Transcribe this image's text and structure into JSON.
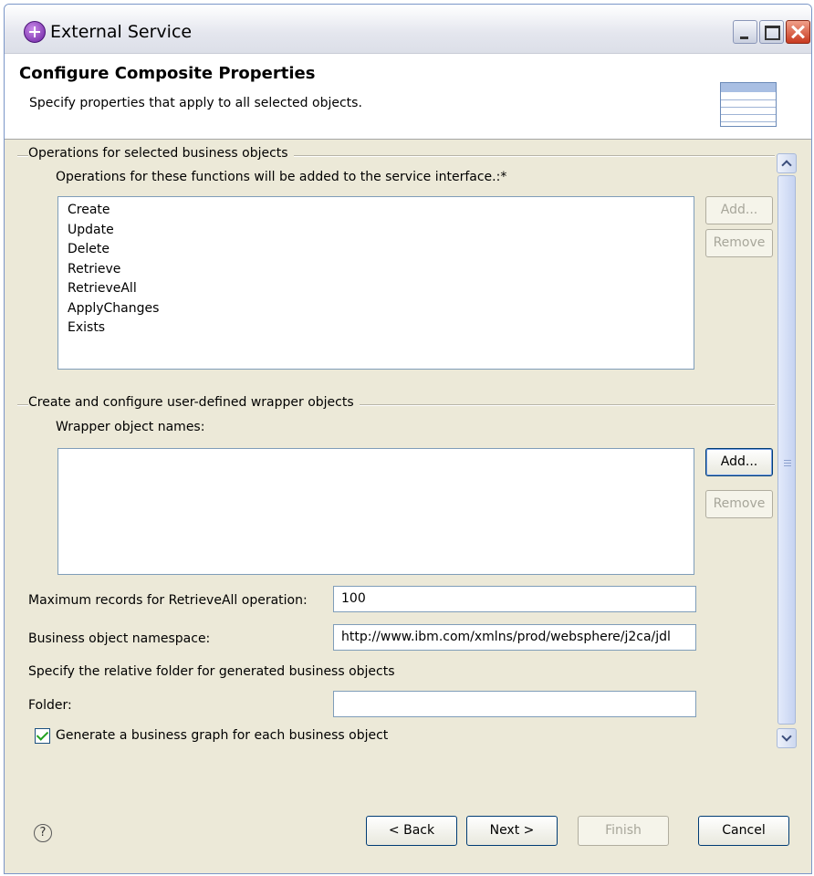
{
  "window": {
    "title": "External Service",
    "controls": [
      "minimize",
      "maximize",
      "close"
    ]
  },
  "banner": {
    "title": "Configure Composite Properties",
    "description": "Specify properties that apply to all selected objects.",
    "graphic_icon": "table-wizard-graphic"
  },
  "operations_group": {
    "title": "Operations for selected business objects",
    "list_label": "Operations for these functions will be added to the service interface.:*",
    "items": [
      "Create",
      "Update",
      "Delete",
      "Retrieve",
      "RetrieveAll",
      "ApplyChanges",
      "Exists"
    ],
    "add_label": "Add...",
    "add_enabled": false,
    "remove_label": "Remove",
    "remove_enabled": false
  },
  "wrapper_group": {
    "title": "Create and configure user-defined wrapper objects",
    "list_label": "Wrapper object names:",
    "items": [],
    "add_label": "Add...",
    "add_enabled": true,
    "remove_label": "Remove",
    "remove_enabled": false
  },
  "max_records": {
    "label": "Maximum records for RetrieveAll operation:",
    "value": "100"
  },
  "namespace": {
    "label": "Business object namespace:",
    "value": "http://www.ibm.com/xmlns/prod/websphere/j2ca/jdl"
  },
  "folder": {
    "description": "Specify the relative folder for generated business objects",
    "label": "Folder:",
    "value": ""
  },
  "business_graph": {
    "label": "Generate a business graph for each business object",
    "checked": true
  },
  "footer": {
    "help_icon": "?",
    "back_label": "< Back",
    "next_label": "Next >",
    "finish_label": "Finish",
    "cancel_label": "Cancel"
  }
}
